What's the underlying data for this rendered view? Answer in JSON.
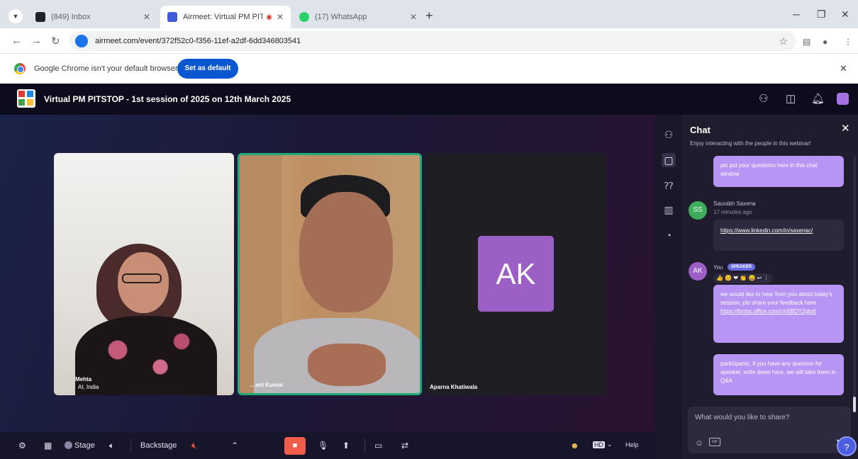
{
  "browser": {
    "tabs": [
      {
        "title": "(849) Inbox",
        "active": false,
        "favicon_color": "#202124"
      },
      {
        "title": "Airmeet: Virtual PM PITSTO",
        "active": true,
        "favicon_color": "#3f5bd8"
      },
      {
        "title": "(17) WhatsApp",
        "active": false,
        "favicon_color": "#25d366"
      }
    ],
    "address": "airmeet.com/event/372f52c0-f356-11ef-a2df-6dd346803541"
  },
  "infobar": {
    "message": "Google Chrome isn't your default browser",
    "button": "Set as default"
  },
  "app": {
    "title": "Virtual PM PITSTOP - 1st session of 2025 on 12th March 2025"
  },
  "stage": {
    "tiles": [
      {
        "name": "Mehta",
        "org": "AI, India"
      },
      {
        "name": "…ant Kumar"
      },
      {
        "name": "Aparna Khatiwala",
        "initials": "AK"
      }
    ]
  },
  "chat": {
    "title": "Chat",
    "subtitle": "Enjoy interacting with the people in this webinar!",
    "messages": {
      "m1": "pls put your questions here in this chat window",
      "saurabh_initials": "SS",
      "saurabh_name": "Saurabh Saxena",
      "saurabh_time": "17 minutes ago",
      "saurabh_link": "https://www.linkedin.com/in/saxenac/",
      "you_initials": "AK",
      "you_label": "You",
      "speaker_badge": "SPEAKER",
      "reactions": "👍 😊 ❤ 👏 😄   ↩ ⋮",
      "m2_text": "we would like to hear from you about today's session, pls share your feedback here",
      "m2_link": "https://forms.office.com/r/n5BDY2gtg6",
      "m3": "participants, if you have any question for speaker, write down here, we will take them in Q&A"
    },
    "placeholder": "What would you like to share?",
    "gif": "GIF"
  },
  "controls": {
    "stage": "Stage",
    "backstage": "Backstage",
    "help": "Help",
    "hd": "HD"
  },
  "colors": {
    "accent": "#b795f5",
    "active_speaker_border": "#1fae7a",
    "cam_off": "#f25c4a",
    "primary_button": "#0b57d0"
  }
}
